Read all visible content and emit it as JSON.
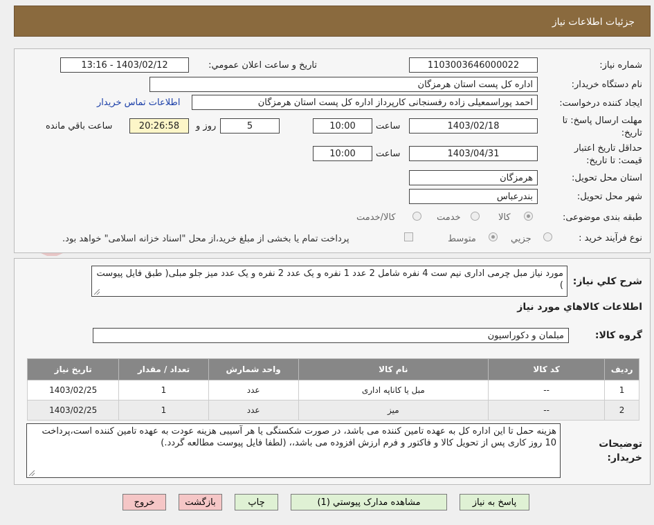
{
  "header": {
    "title": "جزئیات اطلاعات نیاز"
  },
  "labels": {
    "need_number": "شماره نیاز:",
    "announce_datetime": "تاریخ و ساعت اعلان عمومي:",
    "buyer_org": "نام دستگاه خريدار:",
    "requester": "ايجاد کننده درخواست:",
    "reply_deadline": "مهلت ارسال پاسخ: تا تاریخ:",
    "time": "ساعت",
    "day_and": "روز و",
    "remaining": "ساعت باقي مانده",
    "price_validity": "حداقل تاريخ اعتبار قيمت: تا تاريخ:",
    "delivery_province": "استان محل تحويل:",
    "delivery_city": "شهر محل تحويل:",
    "category": "طبقه بندی موضوعی:",
    "purchase_type": "نوع فرآيند خريد :",
    "description": "شرح کلي نياز:",
    "goods_info": "اطلاعات کالاهاي مورد نياز",
    "goods_group": "گروه کالا:",
    "buyer_notes": "توضيحات خريدار:"
  },
  "values": {
    "need_number": "1103003646000022",
    "announce_datetime": "1403/02/12 - 13:16",
    "buyer_org": "اداره کل پست استان هرمزگان",
    "requester": "احمد پوراسمعیلی زاده رفسنجانی کارپرداز اداره کل پست استان هرمزگان",
    "contact_link": "اطلاعات تماس خريدار",
    "reply_date": "1403/02/18",
    "reply_time": "10:00",
    "reply_days": "5",
    "reply_remaining": "20:26:58",
    "validity_date": "1403/04/31",
    "validity_time": "10:00",
    "province": "هرمزگان",
    "city": "بندرعباس",
    "description": "مورد نیاز مبل چرمی اداری نیم ست 4 نفره شامل 2 عدد 1 نفره و یک عدد 2 نفره و یک عدد میز جلو مبلی( طبق فایل پیوست )",
    "goods_group": "مبلمان و دکوراسیون",
    "buyer_notes": "هزینه حمل تا این اداره کل به عهده تامین کننده می باشد، در صورت شکستگی یا هر آسیبی هزینه عودت به عهده تامین کننده است،پرداخت 10 روز کاری پس از تحویل کالا و فاکتور و فرم ارزش افزوده می باشد،، (لطفا فایل پیوست مطالعه گردد.)"
  },
  "category_options": [
    "کالا",
    "خدمت",
    "کالا/خدمت"
  ],
  "category_selected": "کالا",
  "purchase_options": [
    "جزيي",
    "متوسط"
  ],
  "purchase_selected": "متوسط",
  "treasury_note": "پرداخت تمام يا بخشی از مبلغ خريد،از محل \"اسناد خزانه اسلامی\" خواهد بود.",
  "watermark_text": "AriaTender.net",
  "table": {
    "headers": [
      "رديف",
      "کد کالا",
      "نام کالا",
      "واحد شمارش",
      "تعداد / مقدار",
      "تاريخ نياز"
    ],
    "rows": [
      [
        "1",
        "--",
        "مبل یا کاناپه اداری",
        "عدد",
        "1",
        "1403/02/25"
      ],
      [
        "2",
        "--",
        "میز",
        "عدد",
        "1",
        "1403/02/25"
      ]
    ]
  },
  "buttons": {
    "reply": "پاسخ به نياز",
    "attachments": "مشاهده مدارک پيوستي (1)",
    "print": "چاپ",
    "back": "بازگشت",
    "exit": "خروج"
  },
  "colors": {
    "header_bg": "#8a6a3e",
    "table_header_bg": "#878787",
    "button_green": "#dff1d4",
    "button_pink": "#f5c6c6",
    "link": "#1a3ea8"
  }
}
